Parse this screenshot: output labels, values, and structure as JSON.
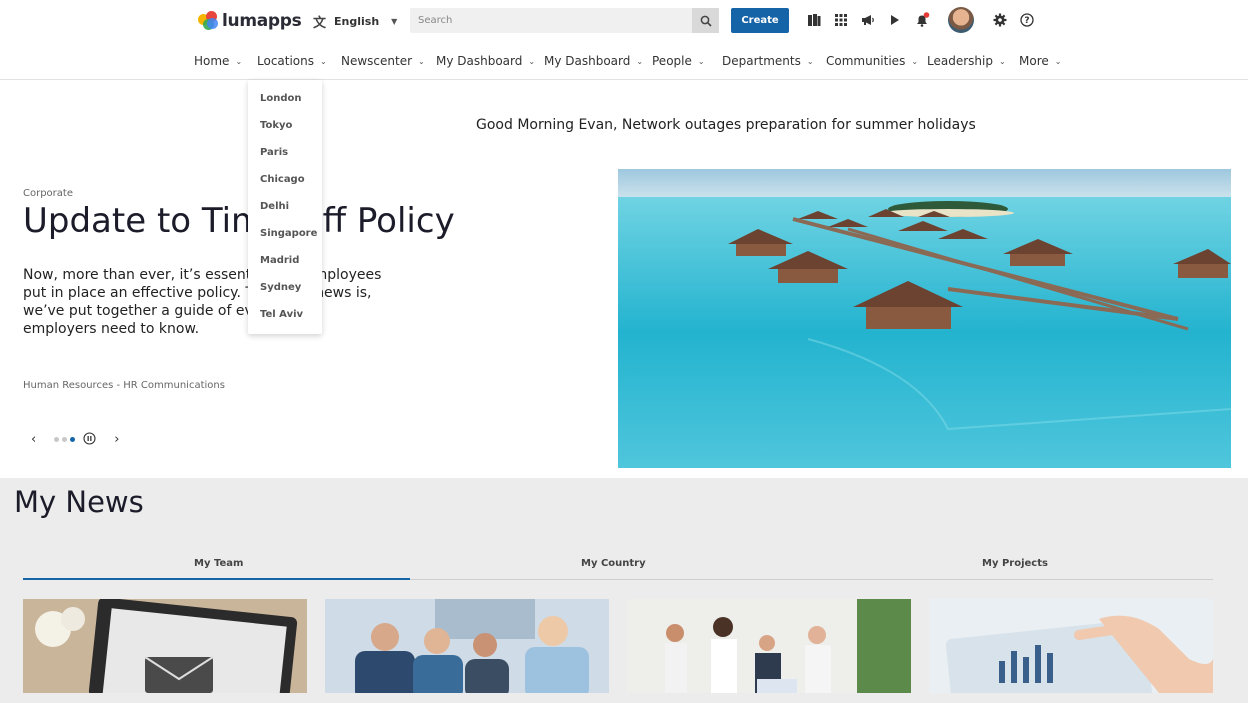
{
  "header": {
    "logo_text": "lumapps",
    "language": "English",
    "search_placeholder": "Search",
    "create_label": "Create",
    "icons": [
      "bookmarks-icon",
      "apps-grid-icon",
      "megaphone-icon",
      "play-icon",
      "notifications-icon",
      "settings-icon",
      "help-icon"
    ],
    "accent_color": "#1664a8"
  },
  "nav": {
    "items": [
      {
        "label": "Home"
      },
      {
        "label": "Locations"
      },
      {
        "label": "Newscenter"
      },
      {
        "label": "My Dashboard"
      },
      {
        "label": "My Dashboard"
      },
      {
        "label": "People"
      },
      {
        "label": "Departments"
      },
      {
        "label": "Communities"
      },
      {
        "label": "Leadership"
      },
      {
        "label": "More"
      }
    ]
  },
  "locations_menu": [
    "London",
    "Tokyo",
    "Paris",
    "Chicago",
    "Delhi",
    "Singapore",
    "Madrid",
    "Sydney",
    "Tel Aviv"
  ],
  "hero": {
    "greeting": "Good Morning Evan, Network outages preparation for summer holidays",
    "category": "Corporate",
    "title": "Update to Time Off Policy",
    "body": "Now, more than ever, it’s essential that employees put in place an effective policy. The good news is, we’ve put together a guide of everything employers need to know.",
    "byline": "Human Resources - HR Communications"
  },
  "news": {
    "title": "My News",
    "tabs": [
      {
        "label": "My Team"
      },
      {
        "label": "My Country"
      },
      {
        "label": "My Projects"
      }
    ]
  }
}
